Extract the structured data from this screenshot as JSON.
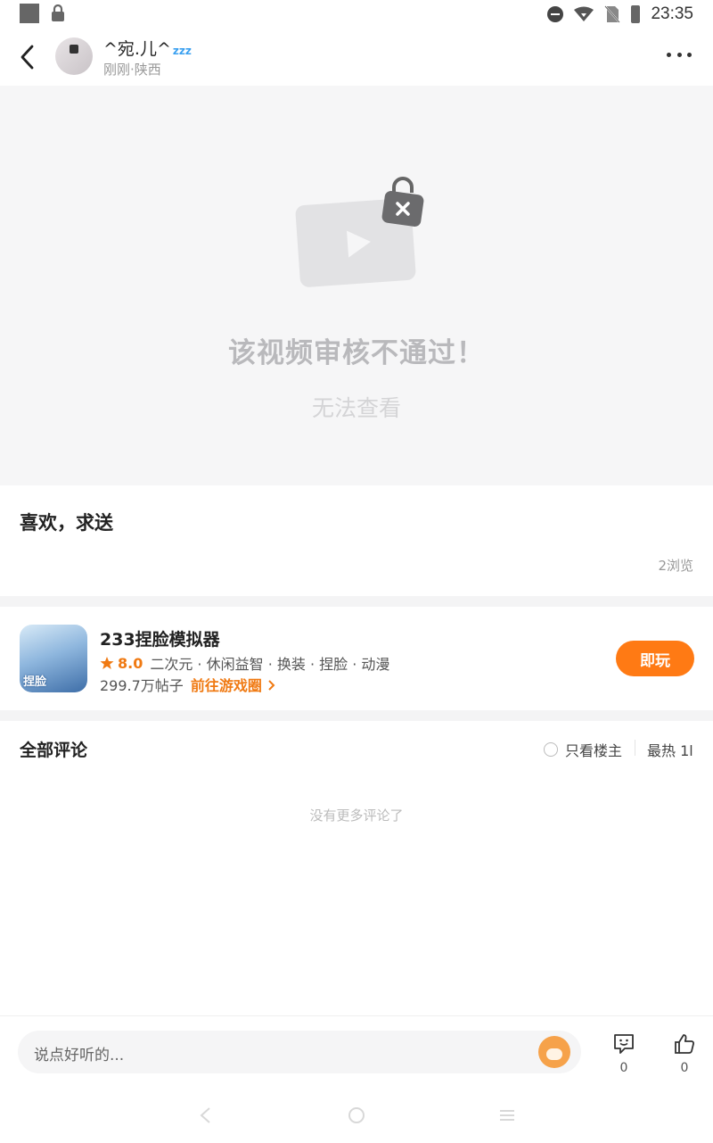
{
  "status_bar": {
    "time": "23:35"
  },
  "header": {
    "username": "^宛.儿^",
    "username_badge": "zzz",
    "meta": "刚刚·陕西"
  },
  "video": {
    "status_title": "该视频审核不通过！",
    "status_subtitle": "无法查看"
  },
  "post": {
    "text": "喜欢，求送",
    "views": "2浏览"
  },
  "game": {
    "name": "233捏脸模拟器",
    "icon_text": "捏脸",
    "rating": "8.0",
    "tags": "二次元 · 休闲益智 · 换装 · 捏脸 · 动漫",
    "posts": "299.7万帖子",
    "goto_label": "前往游戏圈",
    "play_label": "即玩"
  },
  "comments": {
    "title": "全部评论",
    "only_op_label": "只看楼主",
    "sort_label": "最热 1l",
    "empty_text": "没有更多评论了"
  },
  "bottom_bar": {
    "input_placeholder": "说点好听的...",
    "comment_count": "0",
    "like_count": "0"
  },
  "colors": {
    "accent": "#ff7a14",
    "rating": "#f07a13",
    "video_bg": "#f6f6f7"
  }
}
